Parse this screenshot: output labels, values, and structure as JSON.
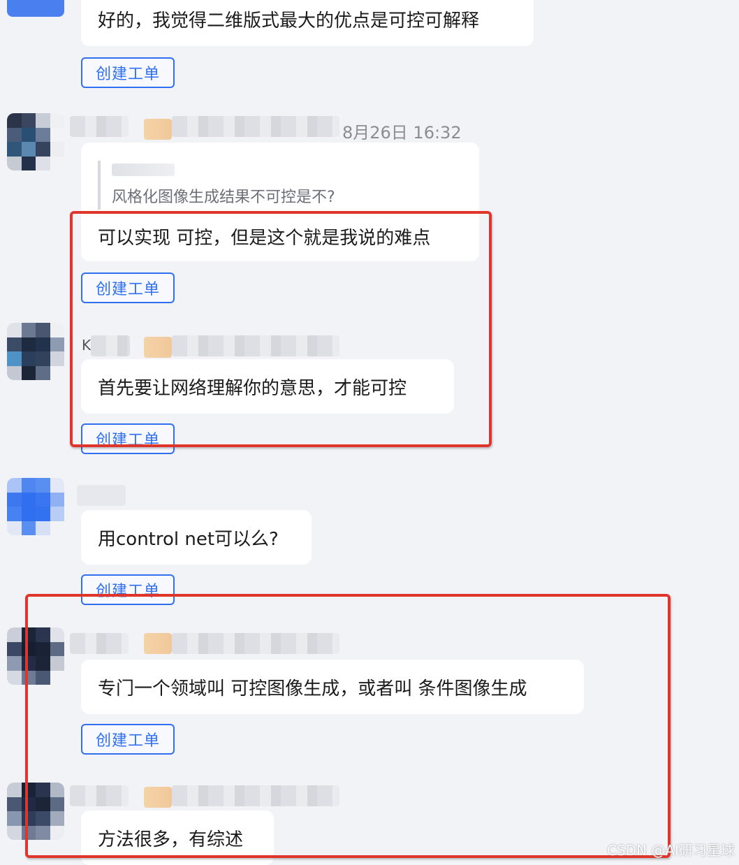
{
  "messages": [
    {
      "text": "好的，我觉得二维版式最大的优点是可控可解释",
      "button": "创建工单"
    },
    {
      "timestamp": "8月26日 16:32",
      "quote": "风格化图像生成结果不可控是不?",
      "text": "可以实现 可控，但是这个就是我说的难点",
      "button": "创建工单"
    },
    {
      "text": "首先要让网络理解你的意思，才能可控",
      "button": "创建工单"
    },
    {
      "text": "用control net可以么?",
      "button": "创建工单"
    },
    {
      "text": "专门一个领域叫 可控图像生成，或者叫 条件图像生成",
      "button": "创建工单"
    },
    {
      "text": "方法很多，有综述"
    }
  ],
  "watermark": "CSDN @AI研习星球",
  "colors": {
    "accent": "#2f6ff0",
    "highlight": "#e0352b",
    "background": "#f2f3f7"
  }
}
